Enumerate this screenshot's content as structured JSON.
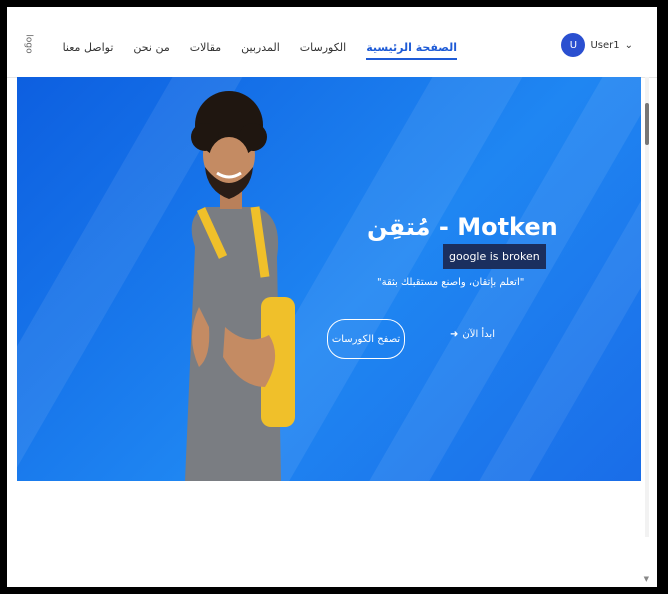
{
  "navbar": {
    "logo": "logo",
    "links": [
      {
        "label": "الصفحة الرئيسية",
        "active": true
      },
      {
        "label": "الكورسات",
        "active": false
      },
      {
        "label": "المدربين",
        "active": false
      },
      {
        "label": "مقالات",
        "active": false
      },
      {
        "label": "من نحن",
        "active": false
      },
      {
        "label": "تواصل معنا",
        "active": false
      }
    ],
    "user": {
      "initial": "U",
      "name": "User1",
      "caret": "⌄"
    }
  },
  "hero": {
    "title": "مُتقِن - Motken",
    "tooltip": "google is broken",
    "tagline": "\"اتعلم بإتقان، واصنع مستقبلك بثقة\"",
    "browse_button": "تصفح الكورسات",
    "start_button": "ابدأ الآن",
    "start_icon": "➜"
  },
  "colors": {
    "accent": "#1e5bd6",
    "hero_blue": "#1a6de8",
    "backpack": "#f0c02a"
  }
}
